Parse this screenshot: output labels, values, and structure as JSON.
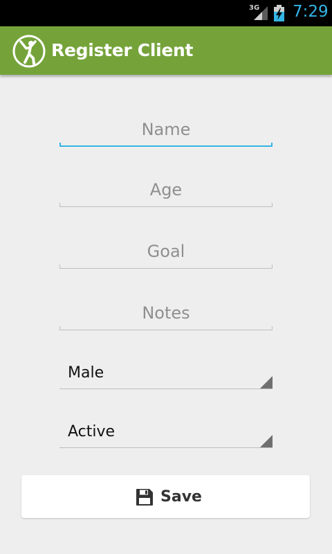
{
  "status_bar": {
    "network": "3G",
    "time": "7:29"
  },
  "action_bar": {
    "title": "Register Client",
    "icon": "fitness-person-icon",
    "color": "#75a33a"
  },
  "form": {
    "name": {
      "placeholder": "Name",
      "value": ""
    },
    "age": {
      "placeholder": "Age",
      "value": ""
    },
    "goal": {
      "placeholder": "Goal",
      "value": ""
    },
    "notes": {
      "placeholder": "Notes",
      "value": ""
    },
    "gender": {
      "selected": "Male"
    },
    "activity": {
      "selected": "Active"
    }
  },
  "save_button": {
    "label": "Save",
    "icon": "floppy-disk-icon"
  },
  "colors": {
    "accent": "#33b5e5",
    "background": "#efeeee"
  }
}
